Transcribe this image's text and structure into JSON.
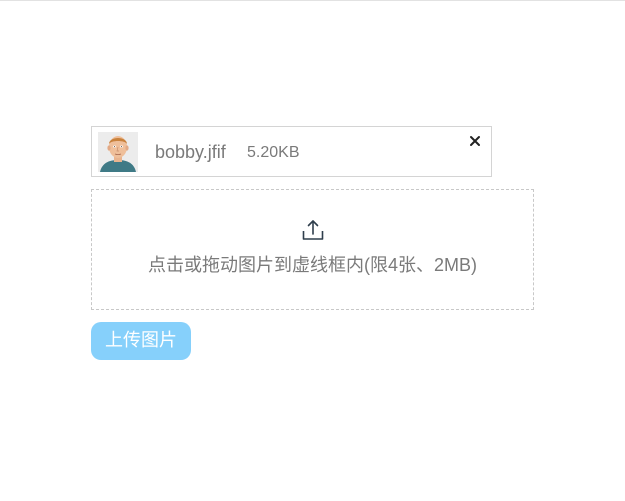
{
  "file": {
    "name": "bobby.jfif",
    "size": "5.20KB",
    "thumbnail_icon": "avatar-thumbnail",
    "remove_icon": "close-icon"
  },
  "dropzone": {
    "icon": "upload-icon",
    "hint": "点击或拖动图片到虚线框内(限4张、2MB)"
  },
  "upload_button": {
    "label": "上传图片",
    "color": "#86d0fb"
  }
}
